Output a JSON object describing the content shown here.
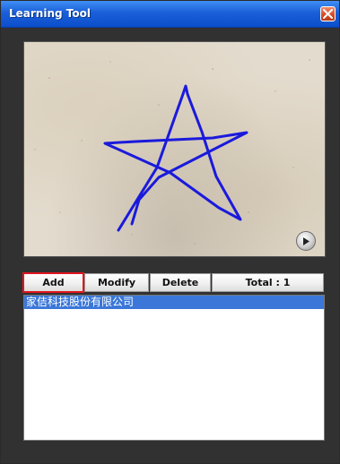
{
  "window": {
    "title": "Learning Tool",
    "close_icon": "close-icon"
  },
  "canvas": {
    "drawing": "star-drawing",
    "stroke_color": "#1a1adc",
    "play_icon": "play-icon"
  },
  "toolbar": {
    "add_label": "Add",
    "modify_label": "Modify",
    "delete_label": "Delete",
    "total_label": "Total : 1",
    "highlight_color": "#e0141e"
  },
  "list": {
    "items": [
      {
        "label": "家佶科技股份有限公司",
        "selected": true
      }
    ],
    "selection_color": "#3a77d8"
  }
}
